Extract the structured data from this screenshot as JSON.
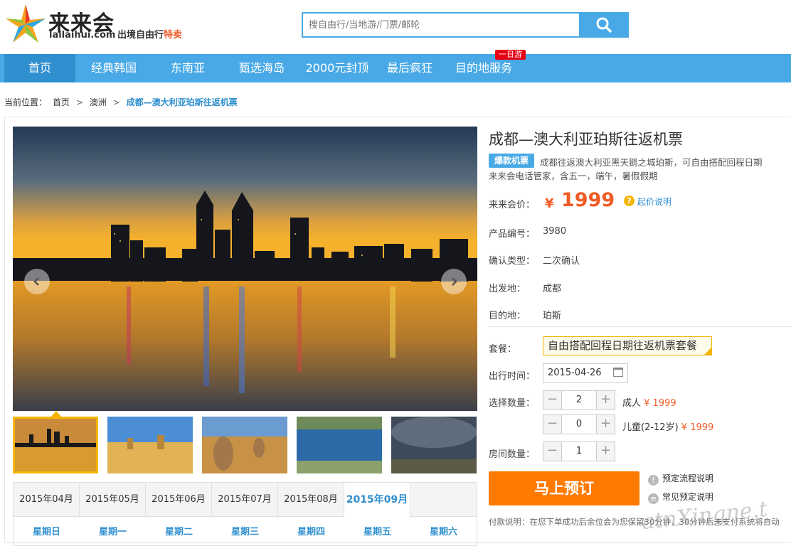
{
  "logo": {
    "name": "来来会",
    "domain": "lailaihui.com",
    "slogan_a": "出境自由行",
    "slogan_b": "特卖"
  },
  "search": {
    "placeholder": "搜自由行/当地游/门票/邮轮"
  },
  "nav": {
    "items": [
      "首页",
      "经典韩国",
      "东南亚",
      "甄选海岛",
      "2000元封顶",
      "最后疯狂",
      "目的地服务"
    ],
    "active": "首页",
    "tag": "一日游"
  },
  "breadcrumb": {
    "prefix": "当前位置：",
    "items": [
      "首页",
      "澳洲"
    ],
    "current": "成都—澳大利亚珀斯往返机票"
  },
  "product": {
    "title": "成都—澳大利亚珀斯往返机票",
    "badge": "爆款机票",
    "desc_line1": "成都往返澳大利亚黑天鹅之城珀斯，可自由搭配回程日期",
    "desc_line2": "来来会电话管家，含五一，端午，暑假假期",
    "price_label": "来来会价：",
    "currency": "¥",
    "price": "1999",
    "price_note": "起价说明",
    "fields": [
      {
        "label": "产品编号：",
        "value": "3980"
      },
      {
        "label": "确认类型：",
        "value": "二次确认"
      },
      {
        "label": "出发地：",
        "value": "成都"
      },
      {
        "label": "目的地：",
        "value": "珀斯"
      }
    ],
    "package_label": "套餐：",
    "package_value": "自由搭配回程日期往返机票套餐",
    "date_label": "出行时间：",
    "date_value": "2015-04-26",
    "qty_label": "选择数量：",
    "adult_qty": "2",
    "adult_label": "成人",
    "adult_price": "¥ 1999",
    "child_qty": "0",
    "child_label": "儿童(2-12岁)",
    "child_price": "¥ 1999",
    "room_label": "房间数量：",
    "room_qty": "1",
    "book_label": "马上预订",
    "help1": "预定流程说明",
    "help2": "常见预定说明",
    "pay_note": "付款说明：在您下单成功后余位会为您保留30分钟，30分钟后未支付系统将自动"
  },
  "calendar": {
    "months": [
      "2015年04月",
      "2015年05月",
      "2015年06月",
      "2015年07月",
      "2015年08月",
      "2015年09月"
    ],
    "active_month": "2015年09月",
    "weekdays": [
      "星期日",
      "星期一",
      "星期二",
      "星期三",
      "星期四",
      "星期五",
      "星期六"
    ]
  },
  "watermark": "atnXingne.t",
  "colors": {
    "nav": "#48a9e6",
    "nav_active": "#2f8fcf",
    "price": "#f15a24",
    "book": "#ff7a00",
    "highlight": "#f5b400"
  }
}
